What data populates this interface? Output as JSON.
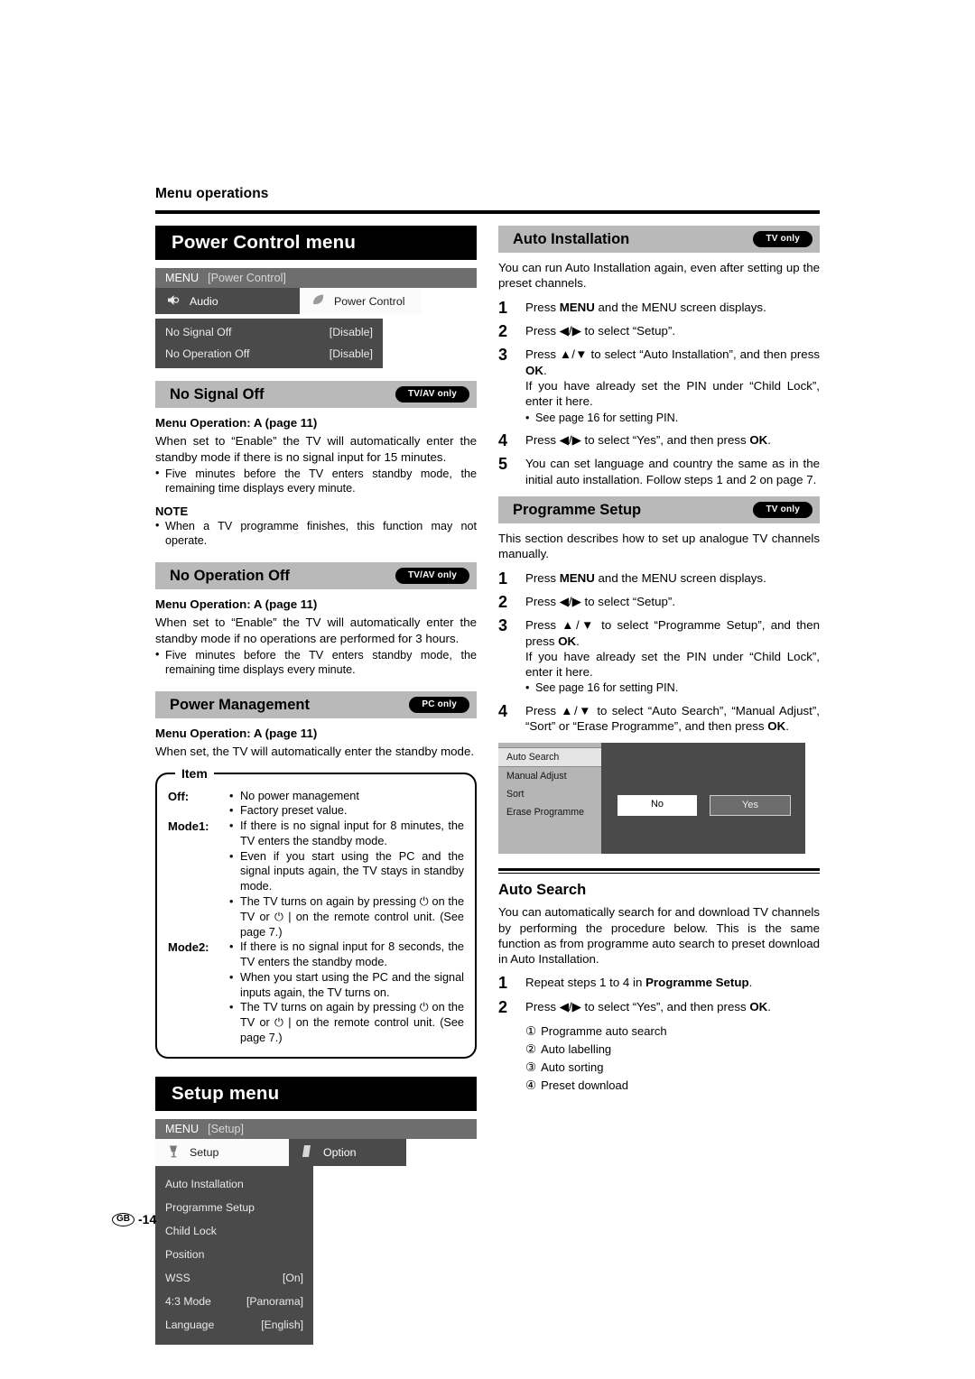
{
  "running_head": "Menu operations",
  "footer": {
    "region": "GB",
    "page": "-14"
  },
  "left_column": {
    "power_control_menu": {
      "title": "Power Control menu",
      "osd": {
        "title_label": "MENU",
        "title_bracket": "[Power Control]",
        "tabs": [
          {
            "label": "Audio",
            "icon": "speaker-icon",
            "active": false
          },
          {
            "label": "Power Control",
            "icon": "leaf-icon",
            "active": true
          }
        ],
        "rows": [
          {
            "label": "No Signal Off",
            "value": "[Disable]"
          },
          {
            "label": "No Operation Off",
            "value": "[Disable]"
          }
        ]
      }
    },
    "no_signal_off": {
      "title": "No Signal Off",
      "badge": "TV/AV only",
      "menu_operation": "Menu Operation: A (page 11)",
      "body": "When set to “Enable” the TV will automatically enter the standby mode if there is no signal input for 15 minutes.",
      "bullets": [
        "Five minutes before the TV enters standby mode, the remaining time displays every minute."
      ],
      "note_title": "NOTE",
      "note_bullets": [
        "When a TV programme finishes, this function may not operate."
      ]
    },
    "no_operation_off": {
      "title": "No Operation Off",
      "badge": "TV/AV only",
      "menu_operation": "Menu Operation: A (page 11)",
      "body": "When set to “Enable” the TV will automatically enter the standby mode if no operations are performed for 3 hours.",
      "bullets": [
        "Five minutes before the TV enters standby mode, the remaining time displays every minute."
      ]
    },
    "power_management": {
      "title": "Power Management",
      "badge": "PC only",
      "menu_operation": "Menu Operation: A (page 11)",
      "body": "When set, the TV will automatically enter the standby mode.",
      "item_box": {
        "legend": "Item",
        "rows": [
          {
            "label": "Off:",
            "bullets": [
              "No power management",
              "Factory preset value."
            ]
          },
          {
            "label": "Mode1:",
            "bullets": [
              "If there is no signal input for 8 minutes, the TV enters the standby mode.",
              "Even if you start using the PC and the signal inputs again, the TV stays in standby mode.",
              "The TV turns on again by pressing ⏻ on the TV or ⏻ | on the remote control unit. (See page 7.)"
            ]
          },
          {
            "label": "Mode2:",
            "bullets": [
              "If there is no signal input for 8 seconds, the TV enters the standby mode.",
              "When you start using the PC and the signal inputs again, the TV turns on.",
              "The TV turns on again by pressing ⏻ on the TV or ⏻ | on the remote control unit. (See page 7.)"
            ]
          }
        ]
      }
    },
    "setup_menu": {
      "title": "Setup menu",
      "osd": {
        "title_label": "MENU",
        "title_bracket": "[Setup]",
        "tabs": [
          {
            "label": "Setup",
            "icon": "tool-icon",
            "active": true
          },
          {
            "label": "Option",
            "icon": "card-icon",
            "active": false
          }
        ],
        "rows": [
          {
            "label": "Auto Installation",
            "value": ""
          },
          {
            "label": "Programme Setup",
            "value": ""
          },
          {
            "label": "Child Lock",
            "value": ""
          },
          {
            "label": "Position",
            "value": ""
          },
          {
            "label": "WSS",
            "value": "[On]"
          },
          {
            "label": "4:3 Mode",
            "value": "[Panorama]"
          },
          {
            "label": "Language",
            "value": "[English]"
          }
        ]
      }
    }
  },
  "right_column": {
    "auto_installation": {
      "title": "Auto Installation",
      "badge": "TV only",
      "intro": "You can run Auto Installation again, even after setting up the preset channels.",
      "steps": [
        {
          "num": "1",
          "text_before": "Press ",
          "bold1": "MENU",
          "text_after": " and the MENU screen displays."
        },
        {
          "num": "2",
          "text_before": "Press ◀/▶ to select “Setup”.",
          "bold1": "",
          "text_after": ""
        },
        {
          "num": "3",
          "text_before": "Press ▲/▼ to select “Auto Installation”, and then press ",
          "bold1": "OK",
          "text_after": ".",
          "extra": "If you have already set the PIN under “Child Lock”, enter it here.",
          "sub": "See page 16 for setting PIN."
        },
        {
          "num": "4",
          "text_before": "Press ◀/▶ to select “Yes”, and then press ",
          "bold1": "OK",
          "text_after": "."
        },
        {
          "num": "5",
          "text_before": "You can set language and country the same as in the initial auto installation. Follow steps 1 and 2 on page 7.",
          "bold1": "",
          "text_after": ""
        }
      ]
    },
    "programme_setup": {
      "title": "Programme Setup",
      "badge": "TV only",
      "intro": "This section describes how to set up analogue TV channels manually.",
      "steps": [
        {
          "num": "1",
          "text_before": "Press ",
          "bold1": "MENU",
          "text_after": " and the MENU screen displays."
        },
        {
          "num": "2",
          "text_before": "Press ◀/▶ to select “Setup”.",
          "bold1": "",
          "text_after": ""
        },
        {
          "num": "3",
          "text_before": "Press ▲/▼ to select “Programme Setup”, and then press ",
          "bold1": "OK",
          "text_after": ".",
          "extra": "If you have already set the PIN under “Child Lock”, enter it here.",
          "sub": "See page 16 for setting PIN."
        },
        {
          "num": "4",
          "text_before": "Press ▲/▼ to select “Auto Search”, “Manual Adjust”, “Sort” or “Erase Programme”, and then press ",
          "bold1": "OK",
          "text_after": "."
        }
      ],
      "screen": {
        "menu_items": [
          {
            "label": "Auto Search",
            "selected": true
          },
          {
            "label": "Manual Adjust",
            "selected": false
          },
          {
            "label": "Sort",
            "selected": false
          },
          {
            "label": "Erase Programme",
            "selected": false
          }
        ],
        "buttons": [
          {
            "label": "No",
            "style": "light"
          },
          {
            "label": "Yes",
            "style": "dark"
          }
        ]
      }
    },
    "auto_search": {
      "title": "Auto Search",
      "intro": "You can automatically search for and download TV channels  by performing the procedure below. This is the same function as from programme auto search to preset download in Auto Installation.",
      "steps": [
        {
          "num": "1",
          "text_before": "Repeat steps 1 to 4 in ",
          "bold1": "Programme Setup",
          "text_after": "."
        },
        {
          "num": "2",
          "text_before": "Press ◀/▶ to select “Yes”, and then press ",
          "bold1": "OK",
          "text_after": "."
        }
      ],
      "numbered_items": [
        {
          "num": "①",
          "label": "Programme auto search"
        },
        {
          "num": "②",
          "label": "Auto labelling"
        },
        {
          "num": "③",
          "label": "Auto sorting"
        },
        {
          "num": "④",
          "label": "Preset download"
        }
      ]
    }
  }
}
